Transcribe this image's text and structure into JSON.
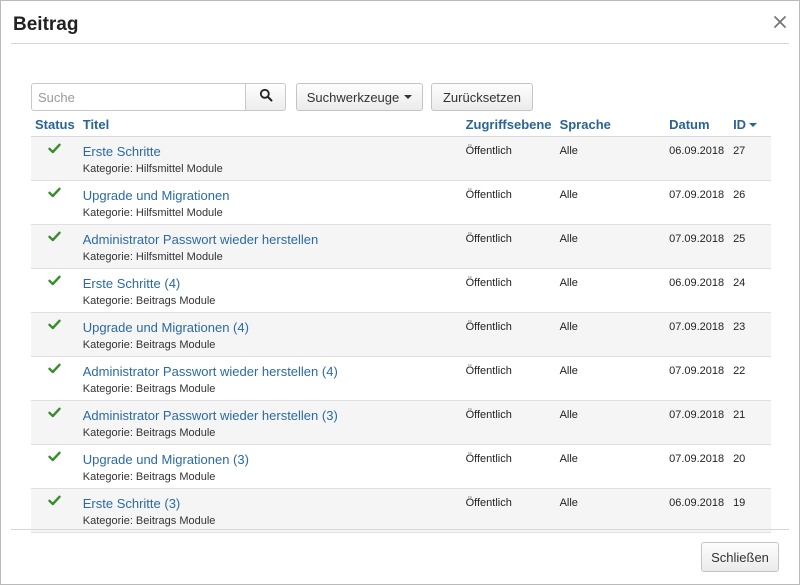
{
  "modal": {
    "title": "Beitrag",
    "close_icon": "close-icon"
  },
  "toolbar": {
    "search_placeholder": "Suche",
    "search_value": "",
    "search_icon": "search-icon",
    "tools_label": "Suchwerkzeuge",
    "reset_label": "Zurücksetzen"
  },
  "table": {
    "headers": {
      "status": "Status",
      "title": "Titel",
      "access": "Zugriffsebene",
      "language": "Sprache",
      "date": "Datum",
      "id": "ID"
    },
    "rows": [
      {
        "title": "Erste Schritte",
        "category": "Kategorie: Hilfsmittel Module",
        "access": "Öffentlich",
        "language": "Alle",
        "date": "06.09.2018",
        "id": "27"
      },
      {
        "title": "Upgrade und Migrationen",
        "category": "Kategorie: Hilfsmittel Module",
        "access": "Öffentlich",
        "language": "Alle",
        "date": "07.09.2018",
        "id": "26"
      },
      {
        "title": "Administrator Passwort wieder herstellen",
        "category": "Kategorie: Hilfsmittel Module",
        "access": "Öffentlich",
        "language": "Alle",
        "date": "07.09.2018",
        "id": "25"
      },
      {
        "title": "Erste Schritte (4)",
        "category": "Kategorie: Beitrags Module",
        "access": "Öffentlich",
        "language": "Alle",
        "date": "06.09.2018",
        "id": "24"
      },
      {
        "title": "Upgrade und Migrationen (4)",
        "category": "Kategorie: Beitrags Module",
        "access": "Öffentlich",
        "language": "Alle",
        "date": "07.09.2018",
        "id": "23"
      },
      {
        "title": "Administrator Passwort wieder herstellen (4)",
        "category": "Kategorie: Beitrags Module",
        "access": "Öffentlich",
        "language": "Alle",
        "date": "07.09.2018",
        "id": "22"
      },
      {
        "title": "Administrator Passwort wieder herstellen (3)",
        "category": "Kategorie: Beitrags Module",
        "access": "Öffentlich",
        "language": "Alle",
        "date": "07.09.2018",
        "id": "21"
      },
      {
        "title": "Upgrade und Migrationen (3)",
        "category": "Kategorie: Beitrags Module",
        "access": "Öffentlich",
        "language": "Alle",
        "date": "07.09.2018",
        "id": "20"
      },
      {
        "title": "Erste Schritte (3)",
        "category": "Kategorie: Beitrags Module",
        "access": "Öffentlich",
        "language": "Alle",
        "date": "06.09.2018",
        "id": "19"
      }
    ]
  },
  "footer": {
    "close_label": "Schließen"
  },
  "colors": {
    "link": "#2a6aa6",
    "check": "#3a8c2e",
    "row_alt": "#f5f5f5"
  }
}
